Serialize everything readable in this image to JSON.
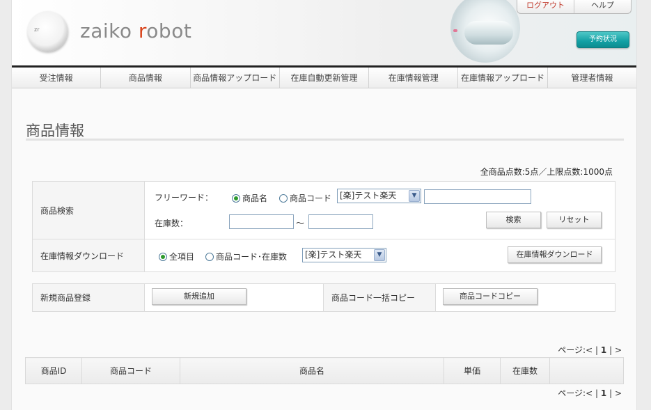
{
  "header": {
    "logo_mark": "zr",
    "logo_text_a": "zaiko ",
    "logo_text_r": "r",
    "logo_text_b": "obot",
    "logout": "ログアウト",
    "help": "ヘルプ",
    "reserve": "予約状況"
  },
  "nav": [
    "受注情報",
    "商品情報",
    "商品情報アップロード",
    "在庫自動更新管理",
    "在庫情報管理",
    "在庫情報アップロード",
    "管理者情報"
  ],
  "page_title": "商品情報",
  "totals": "全商品点数:5点／上限点数:1000点",
  "search": {
    "label": "商品検索",
    "freeword_label": "フリーワード：",
    "opt_name": "商品名",
    "opt_code": "商品コード",
    "shop_select": "[楽]テスト楽天",
    "freeword_value": "",
    "stock_label": "在庫数：",
    "stock_from": "",
    "tilde": "～",
    "stock_to": "",
    "search_button": "検索",
    "reset_button": "リセット"
  },
  "download": {
    "label": "在庫情報ダウンロード",
    "opt_all": "全項目",
    "opt_code_stock": "商品コード･在庫数",
    "shop_select": "[楽]テスト楽天",
    "button": "在庫情報ダウンロード"
  },
  "register": {
    "label": "新規商品登録",
    "button": "新規追加",
    "copy_label": "商品コード一括コピー",
    "copy_button": "商品コードコピー"
  },
  "pager": {
    "prefix": "ページ:",
    "prev": "<",
    "sep1": "|",
    "current": "1",
    "sep2": "|",
    "next": ">"
  },
  "table": {
    "headers": [
      "商品ID",
      "商品コード",
      "商品名",
      "単価",
      "在庫数",
      ""
    ]
  },
  "colors": {
    "accent_teal": "#13a0a4",
    "logout_red": "#c0392b",
    "logo_r": "#d9441c"
  }
}
